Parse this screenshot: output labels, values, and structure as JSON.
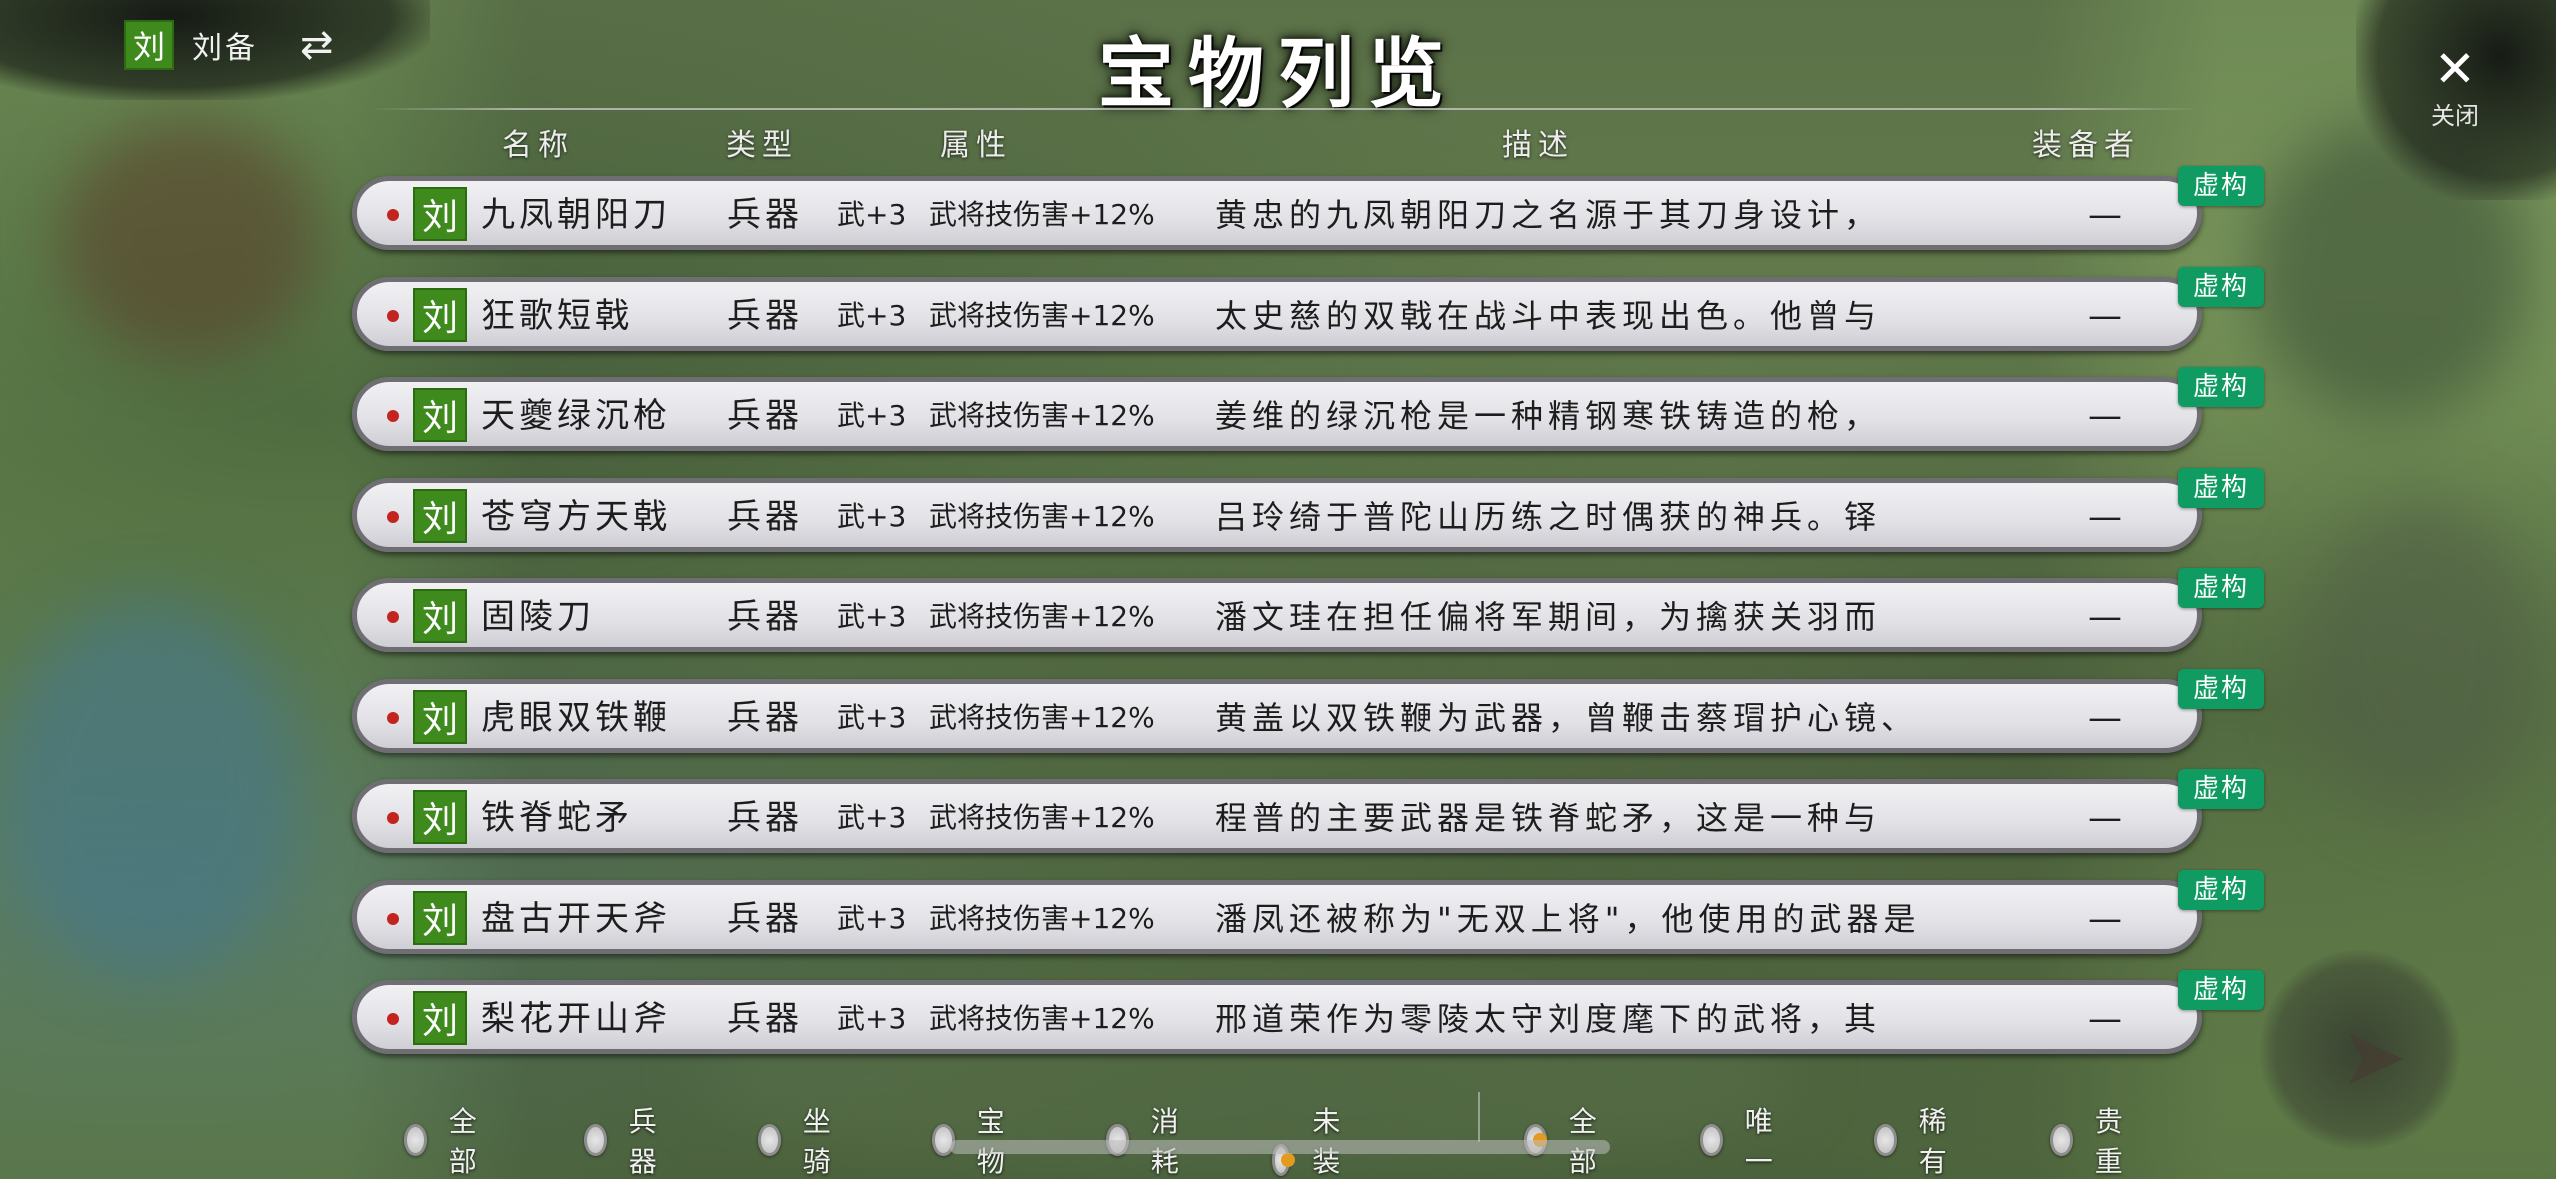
{
  "player": {
    "badge": "刘",
    "name": "刘备",
    "swap_icon": "⇄"
  },
  "title": "宝物列览",
  "close": {
    "icon": "✕",
    "label": "关闭"
  },
  "columns": {
    "name": "名称",
    "type": "类型",
    "attr": "属性",
    "desc": "描述",
    "holder": "装备者"
  },
  "colors": {
    "row_badge": "#3f8a1d",
    "virtual_badge": "#109b62",
    "radio_selected": "#e39a1f",
    "dot": "#c3241f"
  },
  "items": [
    {
      "badge": "刘",
      "name": "九凤朝阳刀",
      "type": "兵器",
      "attr1": "武+3",
      "attr2": "武将技伤害+12%",
      "desc": "黄忠的九凤朝阳刀之名源于其刀身设计，",
      "holder": "—",
      "tag": "虚构"
    },
    {
      "badge": "刘",
      "name": "狂歌短戟",
      "type": "兵器",
      "attr1": "武+3",
      "attr2": "武将技伤害+12%",
      "desc": "太史慈的双戟在战斗中表现出色。他曾与",
      "holder": "—",
      "tag": "虚构"
    },
    {
      "badge": "刘",
      "name": "天夔绿沉枪",
      "type": "兵器",
      "attr1": "武+3",
      "attr2": "武将技伤害+12%",
      "desc": "姜维的绿沉枪是一种精钢寒铁铸造的枪，",
      "holder": "—",
      "tag": "虚构"
    },
    {
      "badge": "刘",
      "name": "苍穹方天戟",
      "type": "兵器",
      "attr1": "武+3",
      "attr2": "武将技伤害+12%",
      "desc": "吕玲绮于普陀山历练之时偶获的神兵。铎",
      "holder": "—",
      "tag": "虚构"
    },
    {
      "badge": "刘",
      "name": "固陵刀",
      "type": "兵器",
      "attr1": "武+3",
      "attr2": "武将技伤害+12%",
      "desc": "潘文珪在担任偏将军期间，为擒获关羽而",
      "holder": "—",
      "tag": "虚构"
    },
    {
      "badge": "刘",
      "name": "虎眼双铁鞭",
      "type": "兵器",
      "attr1": "武+3",
      "attr2": "武将技伤害+12%",
      "desc": "黄盖以双铁鞭为武器，曾鞭击蔡瑁护心镜、",
      "holder": "—",
      "tag": "虚构"
    },
    {
      "badge": "刘",
      "name": "铁脊蛇矛",
      "type": "兵器",
      "attr1": "武+3",
      "attr2": "武将技伤害+12%",
      "desc": "程普的主要武器是铁脊蛇矛，这是一种与",
      "holder": "—",
      "tag": "虚构"
    },
    {
      "badge": "刘",
      "name": "盘古开天斧",
      "type": "兵器",
      "attr1": "武+3",
      "attr2": "武将技伤害+12%",
      "desc": "潘凤还被称为\"无双上将\"，他使用的武器是",
      "holder": "—",
      "tag": "虚构"
    },
    {
      "badge": "刘",
      "name": "梨花开山斧",
      "type": "兵器",
      "attr1": "武+3",
      "attr2": "武将技伤害+12%",
      "desc": "邢道荣作为零陵太守刘度麾下的武将，其",
      "holder": "—",
      "tag": "虚构"
    }
  ],
  "filters_category": [
    {
      "label": "全部",
      "selected": false
    },
    {
      "label": "兵器",
      "selected": false
    },
    {
      "label": "坐骑",
      "selected": false
    },
    {
      "label": "宝物",
      "selected": false
    },
    {
      "label": "消耗",
      "selected": false
    },
    {
      "label": "未装配",
      "selected": true
    }
  ],
  "filters_rarity": [
    {
      "label": "全部",
      "selected": true
    },
    {
      "label": "唯一",
      "selected": false
    },
    {
      "label": "稀有",
      "selected": false
    },
    {
      "label": "贵重",
      "selected": false
    }
  ]
}
